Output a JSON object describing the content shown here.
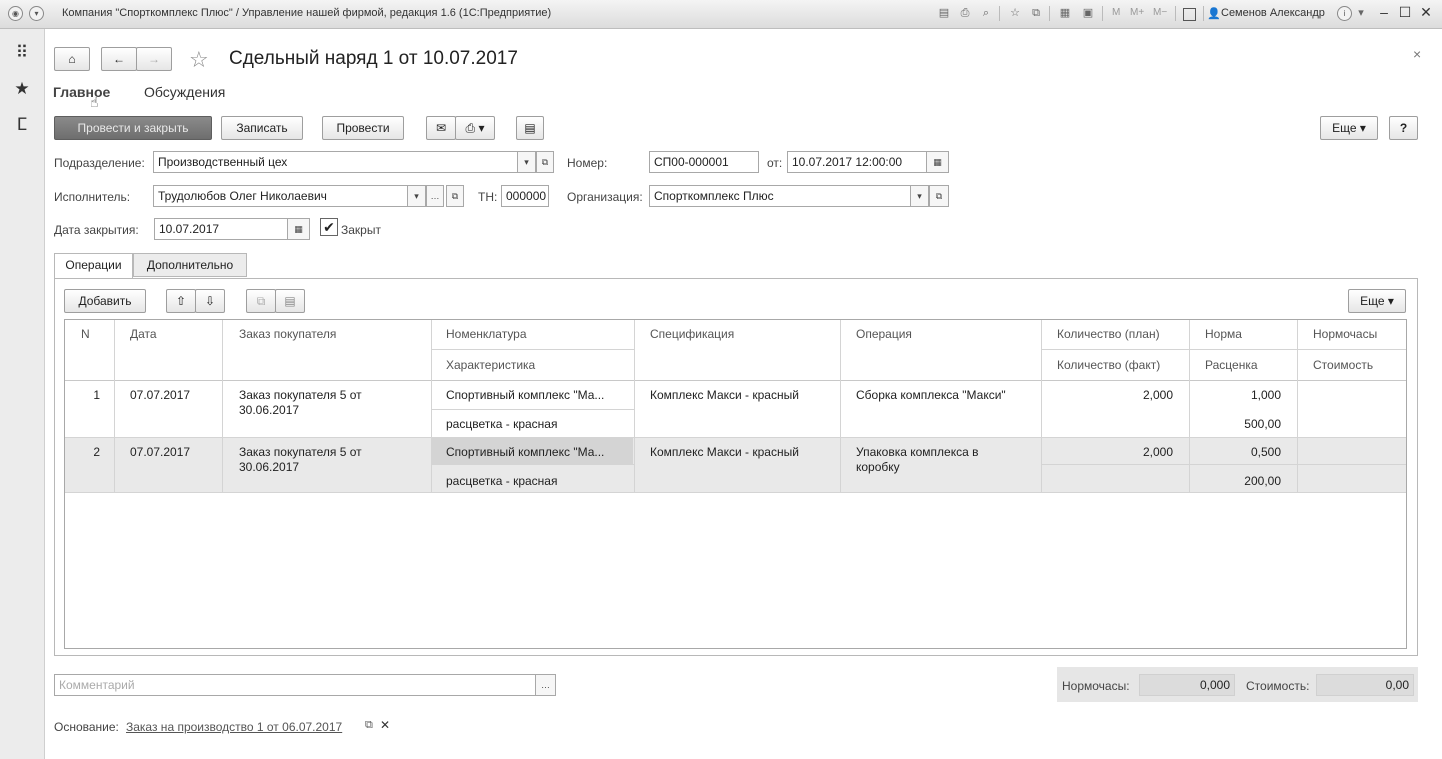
{
  "window": {
    "title": "Компания \"Спорткомплекс Плюс\" / Управление нашей фирмой, редакция 1.6  (1С:Предприятие)",
    "m_buttons": [
      "M",
      "M+",
      "M−"
    ],
    "user": "Семенов Александр"
  },
  "form": {
    "title": "Сдельный наряд 1 от 10.07.2017",
    "tabs": [
      "Главное",
      "Обсуждения"
    ],
    "toolbar": {
      "post_close": "Провести и закрыть",
      "save": "Записать",
      "post": "Провести",
      "more": "Еще",
      "help": "?"
    },
    "fields": {
      "subdivision_label": "Подразделение:",
      "subdivision_value": "Производственный цех",
      "number_label": "Номер:",
      "number_value": "СП00-000001",
      "date_label": "от:",
      "date_value": "10.07.2017 12:00:00",
      "executor_label": "Исполнитель:",
      "executor_value": "Трудолюбов Олег Николаевич",
      "tn_label": "ТН:",
      "tn_value": "000000",
      "org_label": "Организация:",
      "org_value": "Спорткомплекс Плюс",
      "close_date_label": "Дата закрытия:",
      "close_date_value": "10.07.2017",
      "closed_label": "Закрыт",
      "closed_checked": true
    },
    "inner_tabs": [
      "Операции",
      "Дополнительно"
    ],
    "table_toolbar": {
      "add": "Добавить",
      "more": "Еще"
    },
    "table": {
      "headers": {
        "n": "N",
        "date": "Дата",
        "order": "Заказ покупателя",
        "nomenclature": "Номенклатура",
        "characteristic": "Характеристика",
        "specification": "Спецификация",
        "operation": "Операция",
        "qty_plan": "Количество (план)",
        "qty_fact": "Количество (факт)",
        "norm": "Норма",
        "rate": "Расценка",
        "norm_hours": "Нормочасы",
        "cost": "Стоимость"
      },
      "rows": [
        {
          "n": "1",
          "date": "07.07.2017",
          "order_1": "Заказ покупателя 5 от",
          "order_2": "30.06.2017",
          "nomenclature": "Спортивный комплекс \"Ма...",
          "characteristic": "расцветка - красная",
          "specification": "Комплекс Макси - красный",
          "operation_1": "Сборка комплекса \"Макси\"",
          "operation_2": "",
          "qty_plan": "2,000",
          "norm": "1,000",
          "rate": "500,00"
        },
        {
          "n": "2",
          "date": "07.07.2017",
          "order_1": "Заказ покупателя 5 от",
          "order_2": "30.06.2017",
          "nomenclature": "Спортивный комплекс \"Ма...",
          "characteristic": "расцветка - красная",
          "specification": "Комплекс Макси - красный",
          "operation_1": "Упаковка комплекса в",
          "operation_2": "коробку",
          "qty_plan": "2,000",
          "norm": "0,500",
          "rate": "200,00"
        }
      ]
    },
    "footer": {
      "comment_placeholder": "Комментарий",
      "norm_hours_label": "Нормочасы:",
      "norm_hours_value": "0,000",
      "cost_label": "Стоимость:",
      "cost_value": "0,00",
      "basis_label": "Основание:",
      "basis_link": "Заказ на производство 1 от 06.07.2017"
    }
  }
}
